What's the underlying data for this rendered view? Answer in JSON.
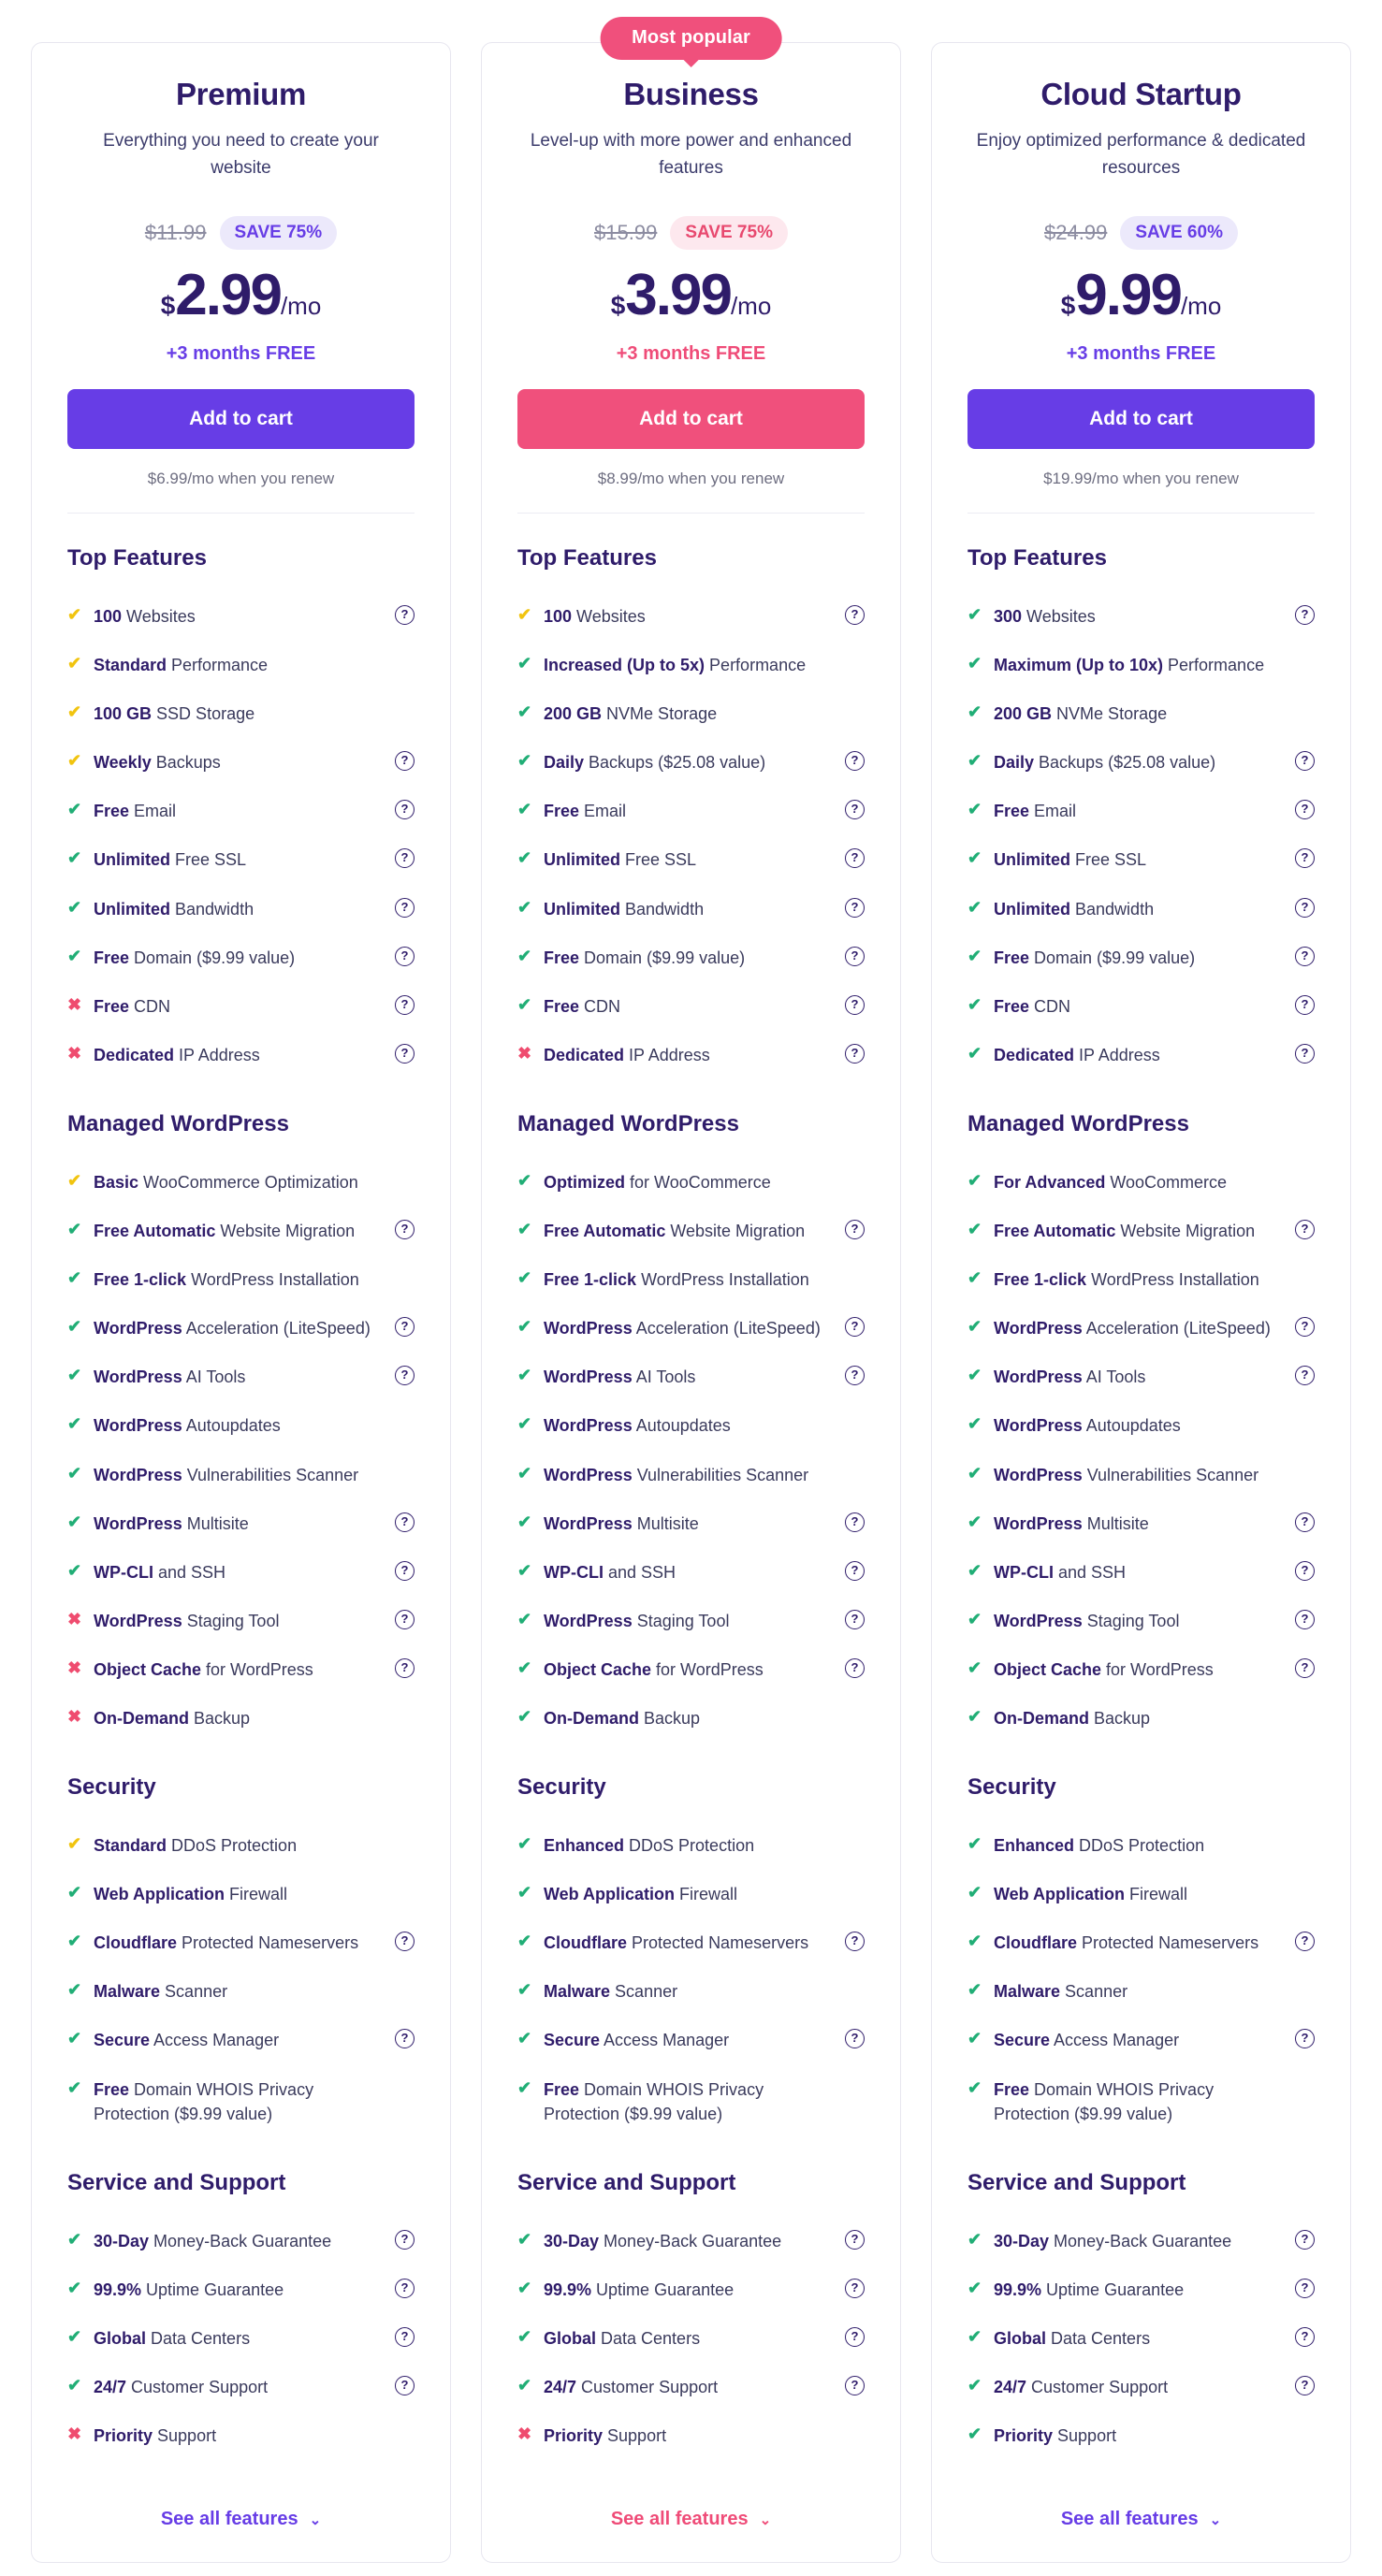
{
  "colors": {
    "purple": "#673de6",
    "pink": "#f0507c",
    "heading": "#2f1c6a",
    "green_check": "#21ae76",
    "yellow_check": "#f1c40f",
    "cross": "#ef4c6f"
  },
  "common": {
    "cta_label": "Add to cart",
    "bonus_label": "+3 months FREE",
    "see_all_label": "See all features",
    "chevron": "⌄",
    "help_glyph": "?",
    "check_glyph": "✔",
    "cross_glyph": "✖",
    "currency": "$",
    "per_month": "/mo",
    "section_titles": {
      "top": "Top Features",
      "wordpress": "Managed WordPress",
      "security": "Security",
      "support": "Service and Support"
    }
  },
  "plans": [
    {
      "id": "premium",
      "accent": "purple",
      "badge": null,
      "name": "Premium",
      "description": "Everything you need to create your website",
      "old_price": "$11.99",
      "save_label": "SAVE 75%",
      "price": "2.99",
      "renew_note": "$6.99/mo when you renew",
      "sections": {
        "top": [
          {
            "mark": "yellow",
            "bold": "100",
            "rest": " Websites",
            "help": true
          },
          {
            "mark": "yellow",
            "bold": "Standard",
            "rest": " Performance",
            "help": false
          },
          {
            "mark": "yellow",
            "bold": "100 GB",
            "rest": " SSD Storage",
            "help": false
          },
          {
            "mark": "yellow",
            "bold": "Weekly",
            "rest": " Backups",
            "help": true
          },
          {
            "mark": "green",
            "bold": "Free",
            "rest": " Email",
            "help": true
          },
          {
            "mark": "green",
            "bold": "Unlimited",
            "rest": " Free SSL",
            "help": true
          },
          {
            "mark": "green",
            "bold": "Unlimited",
            "rest": " Bandwidth",
            "help": true
          },
          {
            "mark": "green",
            "bold": "Free",
            "rest": " Domain ($9.99 value)",
            "help": true
          },
          {
            "mark": "cross",
            "bold": "Free",
            "rest": " CDN",
            "help": true
          },
          {
            "mark": "cross",
            "bold": "Dedicated",
            "rest": " IP Address",
            "help": true
          }
        ],
        "wordpress": [
          {
            "mark": "yellow",
            "bold": "Basic",
            "rest": " WooCommerce Optimization",
            "help": false
          },
          {
            "mark": "green",
            "bold": "Free Automatic",
            "rest": " Website Migration",
            "help": true
          },
          {
            "mark": "green",
            "bold": "Free 1-click",
            "rest": " WordPress Installation",
            "help": false
          },
          {
            "mark": "green",
            "bold": "WordPress",
            "rest": " Acceleration (LiteSpeed)",
            "help": true
          },
          {
            "mark": "green",
            "bold": "WordPress",
            "rest": " AI Tools",
            "help": true
          },
          {
            "mark": "green",
            "bold": "WordPress",
            "rest": " Autoupdates",
            "help": false
          },
          {
            "mark": "green",
            "bold": "WordPress",
            "rest": " Vulnerabilities Scanner",
            "help": false
          },
          {
            "mark": "green",
            "bold": "WordPress",
            "rest": " Multisite",
            "help": true
          },
          {
            "mark": "green",
            "bold": "WP-CLI",
            "rest": " and SSH",
            "help": true
          },
          {
            "mark": "cross",
            "bold": "WordPress",
            "rest": " Staging Tool",
            "help": true
          },
          {
            "mark": "cross",
            "bold": "Object Cache",
            "rest": " for WordPress",
            "help": true
          },
          {
            "mark": "cross",
            "bold": "On-Demand",
            "rest": " Backup",
            "help": false
          }
        ],
        "security": [
          {
            "mark": "yellow",
            "bold": "Standard",
            "rest": " DDoS Protection",
            "help": false
          },
          {
            "mark": "green",
            "bold": "Web Application",
            "rest": " Firewall",
            "help": false
          },
          {
            "mark": "green",
            "bold": "Cloudflare",
            "rest": " Protected Nameservers",
            "help": true
          },
          {
            "mark": "green",
            "bold": "Malware",
            "rest": " Scanner",
            "help": false
          },
          {
            "mark": "green",
            "bold": "Secure",
            "rest": " Access Manager",
            "help": true
          },
          {
            "mark": "green",
            "bold": "Free",
            "rest": " Domain WHOIS Privacy Protection ($9.99 value)",
            "help": false
          }
        ],
        "support": [
          {
            "mark": "green",
            "bold": "30-Day",
            "rest": " Money-Back Guarantee",
            "help": true
          },
          {
            "mark": "green",
            "bold": "99.9%",
            "rest": " Uptime Guarantee",
            "help": true
          },
          {
            "mark": "green",
            "bold": "Global",
            "rest": " Data Centers",
            "help": true
          },
          {
            "mark": "green",
            "bold": "24/7",
            "rest": " Customer Support",
            "help": true
          },
          {
            "mark": "cross",
            "bold": "Priority",
            "rest": " Support",
            "help": false
          }
        ]
      }
    },
    {
      "id": "business",
      "accent": "pink",
      "badge": "Most popular",
      "name": "Business",
      "description": "Level-up with more power and enhanced features",
      "old_price": "$15.99",
      "save_label": "SAVE 75%",
      "price": "3.99",
      "renew_note": "$8.99/mo when you renew",
      "sections": {
        "top": [
          {
            "mark": "yellow",
            "bold": "100",
            "rest": " Websites",
            "help": true
          },
          {
            "mark": "green",
            "bold": "Increased (Up to 5x)",
            "rest": " Performance",
            "help": false
          },
          {
            "mark": "green",
            "bold": "200 GB",
            "rest": " NVMe Storage",
            "help": false
          },
          {
            "mark": "green",
            "bold": "Daily",
            "rest": " Backups ($25.08 value)",
            "help": true
          },
          {
            "mark": "green",
            "bold": "Free",
            "rest": " Email",
            "help": true
          },
          {
            "mark": "green",
            "bold": "Unlimited",
            "rest": " Free SSL",
            "help": true
          },
          {
            "mark": "green",
            "bold": "Unlimited",
            "rest": " Bandwidth",
            "help": true
          },
          {
            "mark": "green",
            "bold": "Free",
            "rest": " Domain ($9.99 value)",
            "help": true
          },
          {
            "mark": "green",
            "bold": "Free",
            "rest": " CDN",
            "help": true
          },
          {
            "mark": "cross",
            "bold": "Dedicated",
            "rest": " IP Address",
            "help": true
          }
        ],
        "wordpress": [
          {
            "mark": "green",
            "bold": "Optimized",
            "rest": " for WooCommerce",
            "help": false
          },
          {
            "mark": "green",
            "bold": "Free Automatic",
            "rest": " Website Migration",
            "help": true
          },
          {
            "mark": "green",
            "bold": "Free 1-click",
            "rest": " WordPress Installation",
            "help": false
          },
          {
            "mark": "green",
            "bold": "WordPress",
            "rest": " Acceleration (LiteSpeed)",
            "help": true
          },
          {
            "mark": "green",
            "bold": "WordPress",
            "rest": " AI Tools",
            "help": true
          },
          {
            "mark": "green",
            "bold": "WordPress",
            "rest": " Autoupdates",
            "help": false
          },
          {
            "mark": "green",
            "bold": "WordPress",
            "rest": " Vulnerabilities Scanner",
            "help": false
          },
          {
            "mark": "green",
            "bold": "WordPress",
            "rest": " Multisite",
            "help": true
          },
          {
            "mark": "green",
            "bold": "WP-CLI",
            "rest": " and SSH",
            "help": true
          },
          {
            "mark": "green",
            "bold": "WordPress",
            "rest": " Staging Tool",
            "help": true
          },
          {
            "mark": "green",
            "bold": "Object Cache",
            "rest": " for WordPress",
            "help": true
          },
          {
            "mark": "green",
            "bold": "On-Demand",
            "rest": " Backup",
            "help": false
          }
        ],
        "security": [
          {
            "mark": "green",
            "bold": "Enhanced",
            "rest": " DDoS Protection",
            "help": false
          },
          {
            "mark": "green",
            "bold": "Web Application",
            "rest": " Firewall",
            "help": false
          },
          {
            "mark": "green",
            "bold": "Cloudflare",
            "rest": " Protected Nameservers",
            "help": true
          },
          {
            "mark": "green",
            "bold": "Malware",
            "rest": " Scanner",
            "help": false
          },
          {
            "mark": "green",
            "bold": "Secure",
            "rest": " Access Manager",
            "help": true
          },
          {
            "mark": "green",
            "bold": "Free",
            "rest": " Domain WHOIS Privacy Protection ($9.99 value)",
            "help": false
          }
        ],
        "support": [
          {
            "mark": "green",
            "bold": "30-Day",
            "rest": " Money-Back Guarantee",
            "help": true
          },
          {
            "mark": "green",
            "bold": "99.9%",
            "rest": " Uptime Guarantee",
            "help": true
          },
          {
            "mark": "green",
            "bold": "Global",
            "rest": " Data Centers",
            "help": true
          },
          {
            "mark": "green",
            "bold": "24/7",
            "rest": " Customer Support",
            "help": true
          },
          {
            "mark": "cross",
            "bold": "Priority",
            "rest": " Support",
            "help": false
          }
        ]
      }
    },
    {
      "id": "cloud-startup",
      "accent": "purple",
      "badge": null,
      "name": "Cloud Startup",
      "description": "Enjoy optimized performance & dedicated resources",
      "old_price": "$24.99",
      "save_label": "SAVE 60%",
      "price": "9.99",
      "renew_note": "$19.99/mo when you renew",
      "sections": {
        "top": [
          {
            "mark": "green",
            "bold": "300",
            "rest": " Websites",
            "help": true
          },
          {
            "mark": "green",
            "bold": "Maximum (Up to 10x)",
            "rest": " Performance",
            "help": false
          },
          {
            "mark": "green",
            "bold": "200 GB",
            "rest": " NVMe Storage",
            "help": false
          },
          {
            "mark": "green",
            "bold": "Daily",
            "rest": " Backups ($25.08 value)",
            "help": true
          },
          {
            "mark": "green",
            "bold": "Free",
            "rest": " Email",
            "help": true
          },
          {
            "mark": "green",
            "bold": "Unlimited",
            "rest": " Free SSL",
            "help": true
          },
          {
            "mark": "green",
            "bold": "Unlimited",
            "rest": " Bandwidth",
            "help": true
          },
          {
            "mark": "green",
            "bold": "Free",
            "rest": " Domain ($9.99 value)",
            "help": true
          },
          {
            "mark": "green",
            "bold": "Free",
            "rest": " CDN",
            "help": true
          },
          {
            "mark": "green",
            "bold": "Dedicated",
            "rest": " IP Address",
            "help": true
          }
        ],
        "wordpress": [
          {
            "mark": "green",
            "bold": "For Advanced",
            "rest": " WooCommerce",
            "help": false
          },
          {
            "mark": "green",
            "bold": "Free Automatic",
            "rest": " Website Migration",
            "help": true
          },
          {
            "mark": "green",
            "bold": "Free 1-click",
            "rest": " WordPress Installation",
            "help": false
          },
          {
            "mark": "green",
            "bold": "WordPress",
            "rest": " Acceleration (LiteSpeed)",
            "help": true
          },
          {
            "mark": "green",
            "bold": "WordPress",
            "rest": " AI Tools",
            "help": true
          },
          {
            "mark": "green",
            "bold": "WordPress",
            "rest": " Autoupdates",
            "help": false
          },
          {
            "mark": "green",
            "bold": "WordPress",
            "rest": " Vulnerabilities Scanner",
            "help": false
          },
          {
            "mark": "green",
            "bold": "WordPress",
            "rest": " Multisite",
            "help": true
          },
          {
            "mark": "green",
            "bold": "WP-CLI",
            "rest": " and SSH",
            "help": true
          },
          {
            "mark": "green",
            "bold": "WordPress",
            "rest": " Staging Tool",
            "help": true
          },
          {
            "mark": "green",
            "bold": "Object Cache",
            "rest": " for WordPress",
            "help": true
          },
          {
            "mark": "green",
            "bold": "On-Demand",
            "rest": " Backup",
            "help": false
          }
        ],
        "security": [
          {
            "mark": "green",
            "bold": "Enhanced",
            "rest": " DDoS Protection",
            "help": false
          },
          {
            "mark": "green",
            "bold": "Web Application",
            "rest": " Firewall",
            "help": false
          },
          {
            "mark": "green",
            "bold": "Cloudflare",
            "rest": " Protected Nameservers",
            "help": true
          },
          {
            "mark": "green",
            "bold": "Malware",
            "rest": " Scanner",
            "help": false
          },
          {
            "mark": "green",
            "bold": "Secure",
            "rest": " Access Manager",
            "help": true
          },
          {
            "mark": "green",
            "bold": "Free",
            "rest": " Domain WHOIS Privacy Protection ($9.99 value)",
            "help": false
          }
        ],
        "support": [
          {
            "mark": "green",
            "bold": "30-Day",
            "rest": " Money-Back Guarantee",
            "help": true
          },
          {
            "mark": "green",
            "bold": "99.9%",
            "rest": " Uptime Guarantee",
            "help": true
          },
          {
            "mark": "green",
            "bold": "Global",
            "rest": " Data Centers",
            "help": true
          },
          {
            "mark": "green",
            "bold": "24/7",
            "rest": " Customer Support",
            "help": true
          },
          {
            "mark": "green",
            "bold": "Priority",
            "rest": " Support",
            "help": false
          }
        ]
      }
    }
  ]
}
